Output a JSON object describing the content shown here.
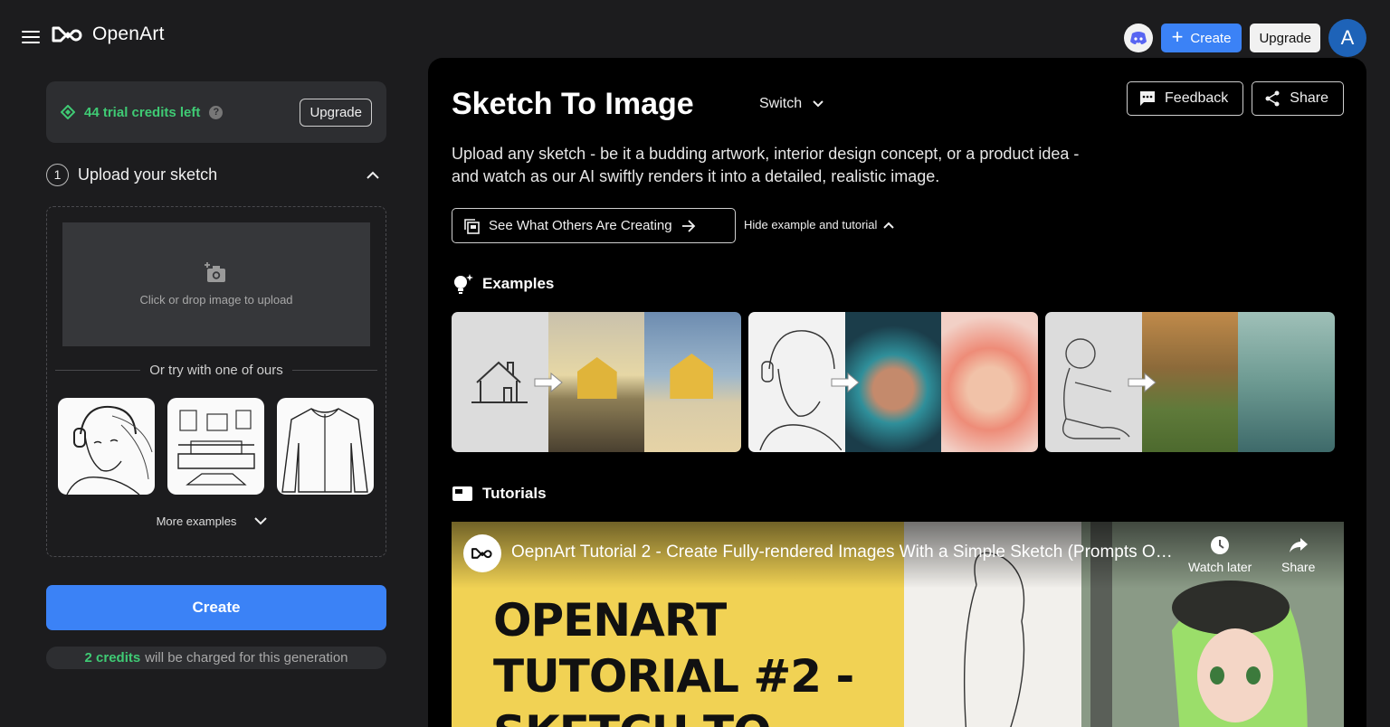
{
  "app": {
    "name": "OpenArt"
  },
  "topbar": {
    "create_label": "Create",
    "upgrade_label": "Upgrade",
    "avatar_initial": "A"
  },
  "left": {
    "credits_text": "44 trial credits left",
    "credits_upgrade": "Upgrade",
    "step_number": "1",
    "step_title": "Upload your sketch",
    "drop_text": "Click or drop image to upload",
    "or_text": "Or try with one of ours",
    "more_examples": "More examples",
    "create_button": "Create",
    "charge_prefix": "2 credits",
    "charge_suffix": "will be charged for this generation"
  },
  "main": {
    "title": "Sketch To Image",
    "switch_label": "Switch",
    "feedback_label": "Feedback",
    "share_label": "Share",
    "description": "Upload any sketch - be it a budding artwork, interior design concept, or a product idea - and watch as our AI swiftly renders it into a detailed, realistic image.",
    "see_others": "See What Others Are Creating",
    "hide_link": "Hide example and tutorial",
    "examples_title": "Examples",
    "tutorials_title": "Tutorials"
  },
  "video": {
    "title": "OepnArt Tutorial 2 - Create Fully-rendered Images With a Simple Sketch (Prompts Opt...",
    "watch_later": "Watch later",
    "share": "Share",
    "big_line1": "OPENART",
    "big_line2": "TUTORIAL #2 -",
    "big_line3": "SKETCH TO"
  },
  "colors": {
    "accent": "#3b82f6",
    "credits_green": "#3fca74"
  }
}
